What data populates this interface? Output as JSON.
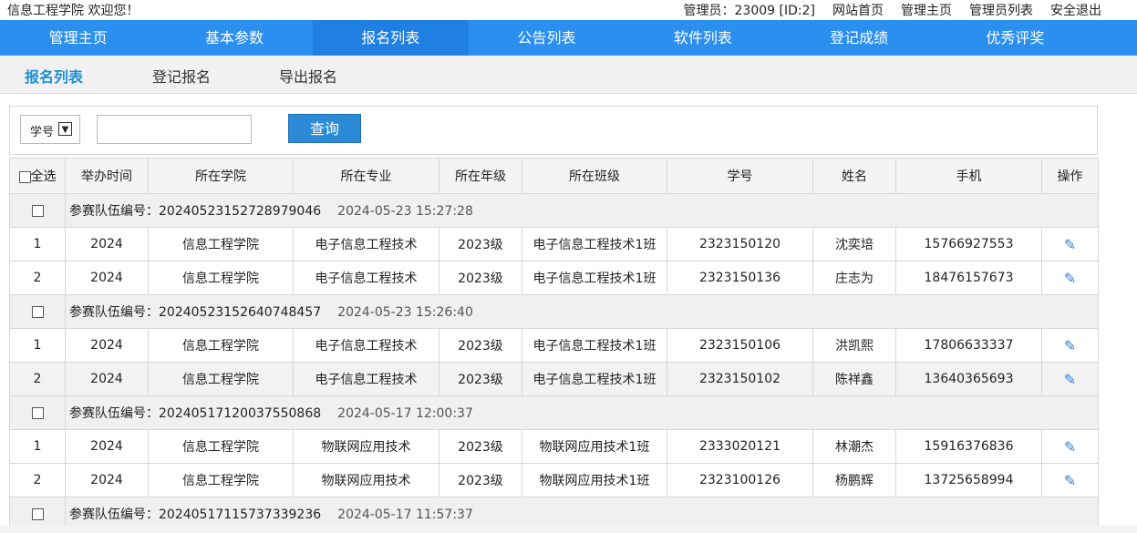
{
  "topbar": {
    "welcome": "信息工程学院 欢迎您！",
    "admin": "管理员：23009 [ID:2]",
    "links": [
      "网站首页",
      "管理主页",
      "管理员列表",
      "安全退出"
    ]
  },
  "nav": [
    "管理主页",
    "基本参数",
    "报名列表",
    "公告列表",
    "软件列表",
    "登记成绩",
    "优秀评奖"
  ],
  "subnav": [
    "报名列表",
    "登记报名",
    "导出报名"
  ],
  "search": {
    "select_value": "学号",
    "button": "查询"
  },
  "table": {
    "select_all": "全选",
    "headers": [
      "举办时间",
      "所在学院",
      "所在专业",
      "所在年级",
      "所在班级",
      "学号",
      "姓名",
      "手机",
      "操作"
    ],
    "team_label": "参赛队伍编号：",
    "teams": [
      {
        "id": "20240523152728979046",
        "time": "2024-05-23 15:27:28",
        "members": [
          [
            "1",
            "2024",
            "信息工程学院",
            "电子信息工程技术",
            "2023级",
            "电子信息工程技术1班",
            "2323150120",
            "沈奕培",
            "15766927553"
          ],
          [
            "2",
            "2024",
            "信息工程学院",
            "电子信息工程技术",
            "2023级",
            "电子信息工程技术1班",
            "2323150136",
            "庄志为",
            "18476157673"
          ]
        ]
      },
      {
        "id": "20240523152640748457",
        "time": "2024-05-23 15:26:40",
        "members": [
          [
            "1",
            "2024",
            "信息工程学院",
            "电子信息工程技术",
            "2023级",
            "电子信息工程技术1班",
            "2323150106",
            "洪凯熙",
            "17806633337"
          ],
          [
            "2",
            "2024",
            "信息工程学院",
            "电子信息工程技术",
            "2023级",
            "电子信息工程技术1班",
            "2323150102",
            "陈祥鑫",
            "13640365693"
          ]
        ]
      },
      {
        "id": "20240517120037550868",
        "time": "2024-05-17 12:00:37",
        "members": [
          [
            "1",
            "2024",
            "信息工程学院",
            "物联网应用技术",
            "2023级",
            "物联网应用技术1班",
            "2333020121",
            "林潮杰",
            "15916376836"
          ],
          [
            "2",
            "2024",
            "信息工程学院",
            "物联网应用技术",
            "2023级",
            "物联网应用技术1班",
            "2323100126",
            "杨鹏辉",
            "13725658994"
          ]
        ]
      },
      {
        "id": "20240517115737339236",
        "time": "2024-05-17 11:57:37",
        "members": []
      }
    ]
  },
  "icons": {
    "edit": "pencil-icon",
    "accent": "#2b8ff0"
  }
}
